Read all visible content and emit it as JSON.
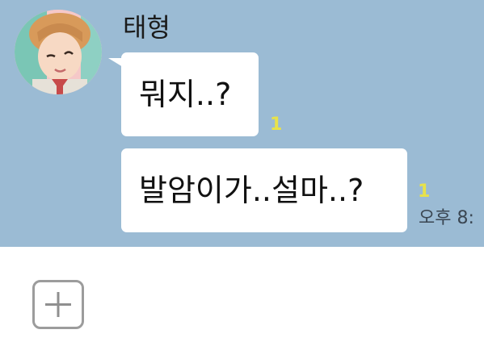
{
  "chat": {
    "background_color": "#9bbbd4",
    "sender": {
      "name": "태형",
      "avatar_icon": "profile-photo"
    },
    "messages": [
      {
        "text": "뭐지..?",
        "unread_count": "1"
      },
      {
        "text": "발암이가..설마..?",
        "unread_count": "1",
        "time": "오후 8:"
      }
    ]
  },
  "composer": {
    "attach_icon": "plus-icon"
  }
}
